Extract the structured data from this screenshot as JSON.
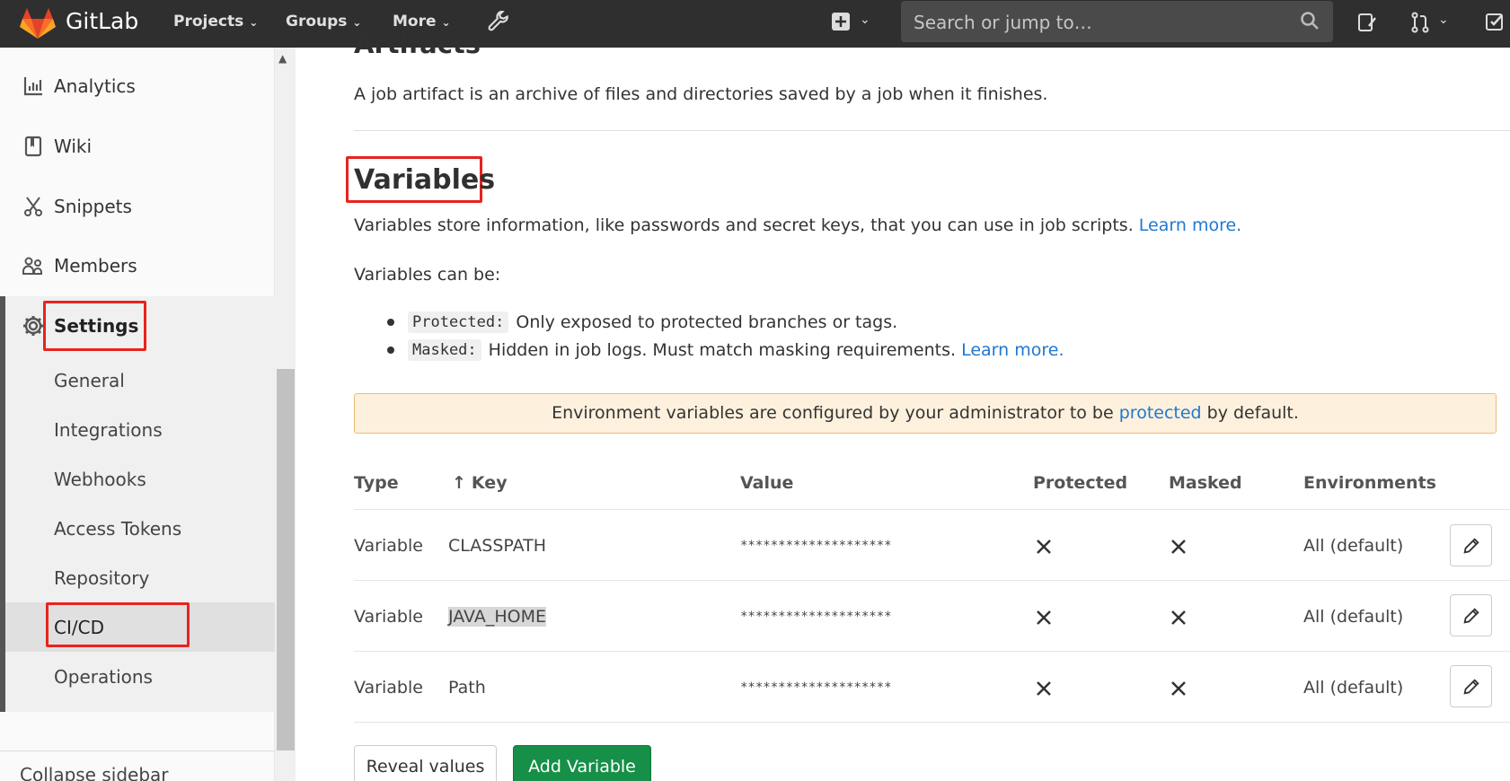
{
  "topbar": {
    "brand": "GitLab",
    "nav": [
      {
        "label": "Projects"
      },
      {
        "label": "Groups"
      },
      {
        "label": "More"
      }
    ],
    "search_placeholder": "Search or jump to…"
  },
  "sidebar": {
    "items": [
      {
        "label": "Analytics",
        "icon": "chart-icon"
      },
      {
        "label": "Wiki",
        "icon": "book-icon"
      },
      {
        "label": "Snippets",
        "icon": "scissors-icon"
      },
      {
        "label": "Members",
        "icon": "users-icon"
      },
      {
        "label": "Settings",
        "icon": "gear-icon"
      }
    ],
    "sub_items": [
      "General",
      "Integrations",
      "Webhooks",
      "Access Tokens",
      "Repository",
      "CI/CD",
      "Operations"
    ],
    "collapse_label": "Collapse sidebar"
  },
  "main": {
    "artifacts_title": "Artifacts",
    "artifacts_desc": "A job artifact is an archive of files and directories saved by a job when it finishes.",
    "variables_title": "Variables",
    "variables_desc": "Variables store information, like passwords and secret keys, that you can use in job scripts.",
    "learn_more": "Learn more.",
    "can_be": "Variables can be:",
    "bullets": [
      {
        "code": "Protected:",
        "text": "Only exposed to protected branches or tags.",
        "link": ""
      },
      {
        "code": "Masked:",
        "text": "Hidden in job logs. Must match masking requirements.",
        "link": "Learn more."
      }
    ],
    "alert": {
      "before": "Environment variables are configured by your administrator to be",
      "link": "protected",
      "after": "by default."
    },
    "table": {
      "headers": [
        "Type",
        "Key",
        "Value",
        "Protected",
        "Masked",
        "Environments"
      ],
      "sort_arrow": "↑",
      "rows": [
        {
          "type": "Variable",
          "key": "CLASSPATH",
          "value": "********************",
          "env": "All (default)"
        },
        {
          "type": "Variable",
          "key": "JAVA_HOME",
          "value": "********************",
          "env": "All (default)"
        },
        {
          "type": "Variable",
          "key": "Path",
          "value": "********************",
          "env": "All (default)"
        }
      ]
    },
    "reveal_button": "Reveal values",
    "add_button": "Add Variable"
  },
  "colors": {
    "topbar": "#2f2f2f",
    "link": "#1f78d1",
    "highlight_box": "#e8231f",
    "add_button": "#168f48",
    "alert_bg": "#fdf1dd"
  }
}
